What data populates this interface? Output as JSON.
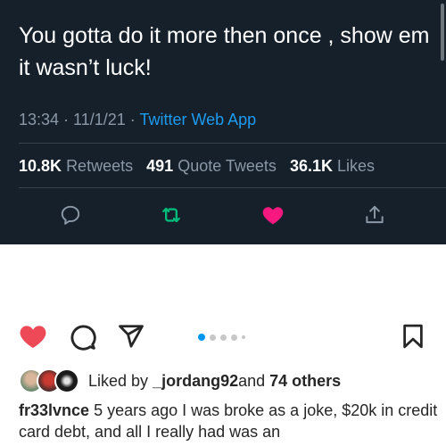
{
  "tweet": {
    "text": "You gotta do it more then once , show em it wasn’t luck!",
    "time": "13:34",
    "sep1": " · ",
    "date": "11/1/21",
    "sep2": " · ",
    "source": "Twitter Web App",
    "retweets_count": "10.8K",
    "retweets_label": "Retweets",
    "quote_count": "491",
    "quote_label": "Quote Tweets",
    "likes_count": "36.1K",
    "likes_label": "Likes",
    "actions": [
      "reply-icon",
      "retweet-icon",
      "like-heart-icon",
      "share-icon"
    ],
    "colors": {
      "background": "#15202b",
      "accent": "#1d9bf0",
      "retweet": "#00ba7c",
      "like": "#f91880"
    }
  },
  "instagram": {
    "actions": [
      "heart-icon",
      "comment-icon",
      "send-icon",
      "bookmark-icon"
    ],
    "carousel": {
      "count": 5,
      "active": 1
    },
    "liked_prefix": "Liked by ",
    "liked_user": "_jordang92",
    "liked_mid": " and ",
    "liked_others": "74 others",
    "caption_user": "fr33lvnce",
    "caption_text": " 5 years ago I was broke as a joke, $20k in credit card debt, and all I really had was an",
    "colors": {
      "heart": "#ed4956",
      "dot_active": "#0095f6"
    }
  }
}
